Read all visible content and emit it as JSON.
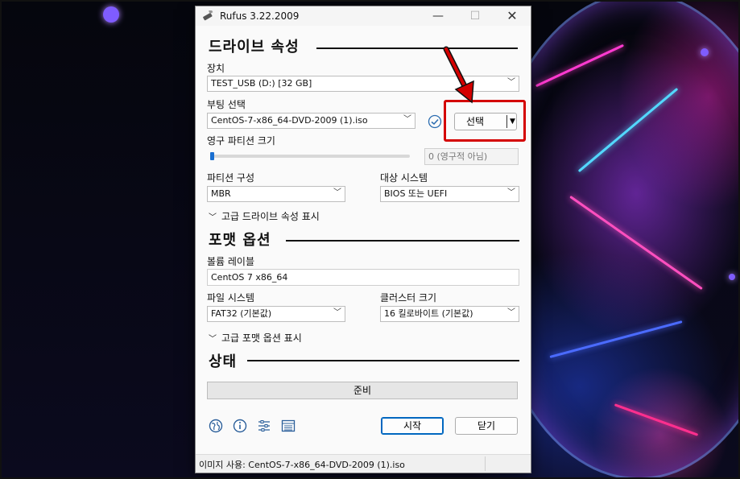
{
  "window": {
    "title": "Rufus 3.22.2009",
    "minimize_glyph": "—",
    "maximize_glyph": "☐",
    "close_glyph": "✕"
  },
  "drive_properties": {
    "heading": "드라이브 속성",
    "device_label": "장치",
    "device_value": "TEST_USB (D:) [32 GB]",
    "boot_selection_label": "부팅 선택",
    "boot_selection_value": "CentOS-7-x86_64-DVD-2009 (1).iso",
    "select_button_label": "선택",
    "persistent_partition_label": "영구 파티션 크기",
    "persistent_partition_value": "0 (영구적 아님)",
    "persistent_partition_fraction": 0,
    "partition_scheme_label": "파티션 구성",
    "partition_scheme_value": "MBR",
    "target_system_label": "대상 시스템",
    "target_system_value": "BIOS 또는 UEFI",
    "advanced_toggle": "고급 드라이브 속성 표시"
  },
  "format_options": {
    "heading": "포맷 옵션",
    "volume_label_label": "볼륨 레이블",
    "volume_label_value": "CentOS 7 x86_64",
    "file_system_label": "파일 시스템",
    "file_system_value": "FAT32 (기본값)",
    "cluster_size_label": "클러스터 크기",
    "cluster_size_value": "16 킬로바이트 (기본값)",
    "advanced_toggle": "고급 포맷 옵션 표시"
  },
  "status": {
    "heading": "상태",
    "text": "준비"
  },
  "actions": {
    "start_label": "시작",
    "close_label": "닫기"
  },
  "toolbar_icons": [
    "globe-icon",
    "info-icon",
    "settings-sliders-icon",
    "log-icon"
  ],
  "footer": {
    "text": "이미지 사용: CentOS-7-x86_64-DVD-2009 (1).iso"
  },
  "colors": {
    "accent": "#1a6fd1",
    "highlight": "#d40000",
    "check": "#2b6cb0"
  }
}
